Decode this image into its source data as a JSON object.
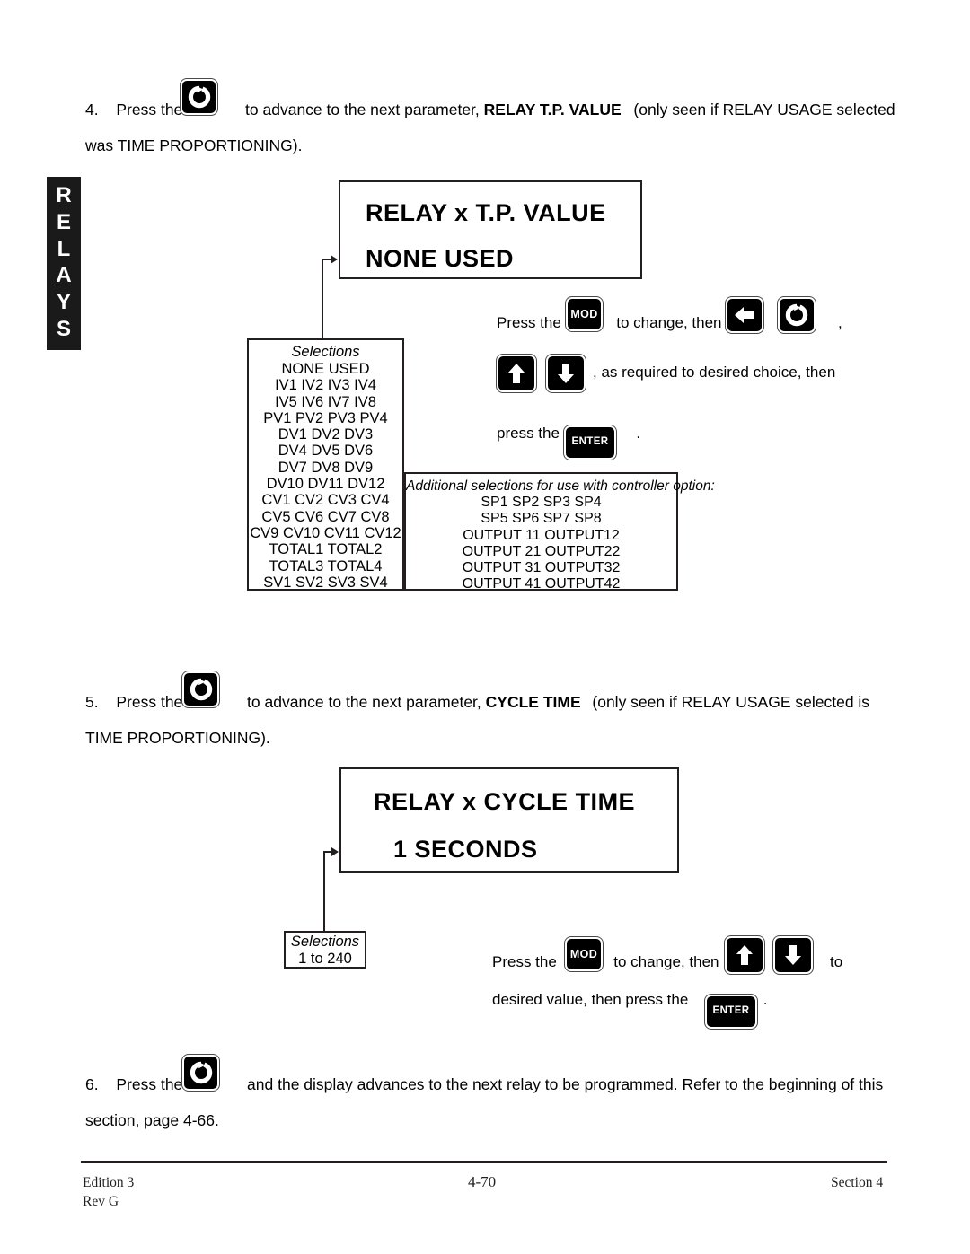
{
  "document": {
    "page_number": "4-70",
    "edition": "Edition 3",
    "revision": "Rev G",
    "section": "Section 4"
  },
  "side_tab": {
    "label": "RELAYS",
    "letters": [
      "R",
      "E",
      "L",
      "A",
      "Y",
      "S"
    ]
  },
  "steps": {
    "step4": {
      "number": "4.",
      "text_before_icon": "Press the",
      "icon": "loop-button-icon",
      "text_a": "to advance to the next parameter,",
      "bold_param": "RELAY T.P. VALUE",
      "text_b": "(only seen if RELAY USAGE selected",
      "line2": "was TIME PROPORTIONING)."
    },
    "step5": {
      "number": "5.",
      "text_before_icon": "Press the",
      "icon": "loop-button-icon",
      "text_a": "to advance to the next parameter,",
      "bold_param": "CYCLE TIME",
      "text_b": "(only seen if RELAY USAGE selected is",
      "line2": "TIME PROPORTIONING)."
    },
    "step6": {
      "number": "6.",
      "text_before_icon": "Press the",
      "icon": "loop-button-icon",
      "text_a": "and the display advances to the next relay to be programmed.  Refer to the beginning of this",
      "line2": "section, page 4-66."
    }
  },
  "display1": {
    "line1": "RELAY x T.P. VALUE",
    "line2": "NONE USED"
  },
  "display2": {
    "line1": "RELAY x CYCLE TIME",
    "line2": "1  SECONDS"
  },
  "selections1": {
    "title": "Selections",
    "rows": [
      "NONE USED",
      "IV1  IV2  IV3  IV4",
      "IV5  IV6  IV7  IV8",
      "PV1  PV2  PV3  PV4",
      "DV1   DV2   DV3",
      "DV4   DV5   DV6",
      "DV7   DV8   DV9",
      "DV10   DV11    DV12",
      "CV1  CV2  CV3  CV4",
      "CV5  CV6  CV7  CV8",
      "CV9  CV10  CV11  CV12",
      "TOTAL1      TOTAL2",
      "TOTAL3      TOTAL4",
      "SV1  SV2  SV3  SV4"
    ]
  },
  "additional_selections": {
    "title": "Additional selections for use with controller option:",
    "rows": [
      "SP1  SP2  SP3  SP4",
      "SP5  SP6  SP7  SP8",
      "OUTPUT 11      OUTPUT12",
      "OUTPUT 21      OUTPUT22",
      "OUTPUT 31      OUTPUT32",
      "OUTPUT 41      OUTPUT42"
    ]
  },
  "selections2": {
    "title": "Selections",
    "range": "1 to 240"
  },
  "instructions1": {
    "line1_a": "Press the",
    "mod_label": "MOD",
    "line1_b": "to change, then",
    "line1_comma": ",",
    "line2_b": ", as required to desired choice, then",
    "line3_a": "press the",
    "enter_label": "ENTER",
    "line3_period": "."
  },
  "instructions2": {
    "line1_a": "Press the",
    "mod_label": "MOD",
    "line1_b": "to change, then",
    "line1_c": "to",
    "line2_a": "desired value, then press the",
    "enter_label": "ENTER",
    "line2_period": "."
  },
  "icons": {
    "loop": "loop-button-icon",
    "left_arrow": "left-arrow-button-icon",
    "up_arrow": "up-arrow-button-icon",
    "down_arrow": "down-arrow-button-icon",
    "mod": "mod-button-icon",
    "enter": "enter-button-icon"
  },
  "colors": {
    "ink": "#231f20",
    "key_fill": "#000000",
    "paper": "#ffffff"
  }
}
